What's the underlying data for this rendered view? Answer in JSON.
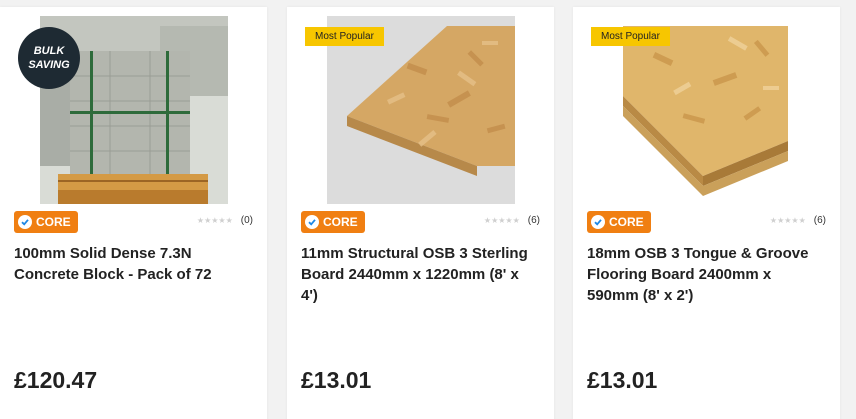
{
  "products": [
    {
      "badge": {
        "type": "bulk",
        "line1": "BULK",
        "line2": "SAVING"
      },
      "image_icon": "concrete-block-pallet-image",
      "core_label": "CORE",
      "rating_count": "(0)",
      "title": "100mm Solid Dense 7.3N Concrete Block - Pack of 72",
      "price": "£120.47"
    },
    {
      "badge": {
        "type": "ribbon",
        "label": "Most Popular"
      },
      "image_icon": "osb-board-image",
      "core_label": "CORE",
      "rating_count": "(6)",
      "title": "11mm Structural OSB 3 Sterling Board 2440mm x 1220mm (8' x 4')",
      "price": "£13.01"
    },
    {
      "badge": {
        "type": "ribbon",
        "label": "Most Popular"
      },
      "image_icon": "tongue-groove-boards-image",
      "core_label": "CORE",
      "rating_count": "(6)",
      "title": "18mm OSB 3 Tongue & Groove Flooring Board 2400mm x 590mm (8' x 2')",
      "price": "£13.01"
    }
  ],
  "colors": {
    "core_orange": "#f07f12",
    "ribbon_yellow": "#f7c600",
    "bulk_navy": "#1e2a33",
    "core_check_blue": "#1e88e5"
  }
}
